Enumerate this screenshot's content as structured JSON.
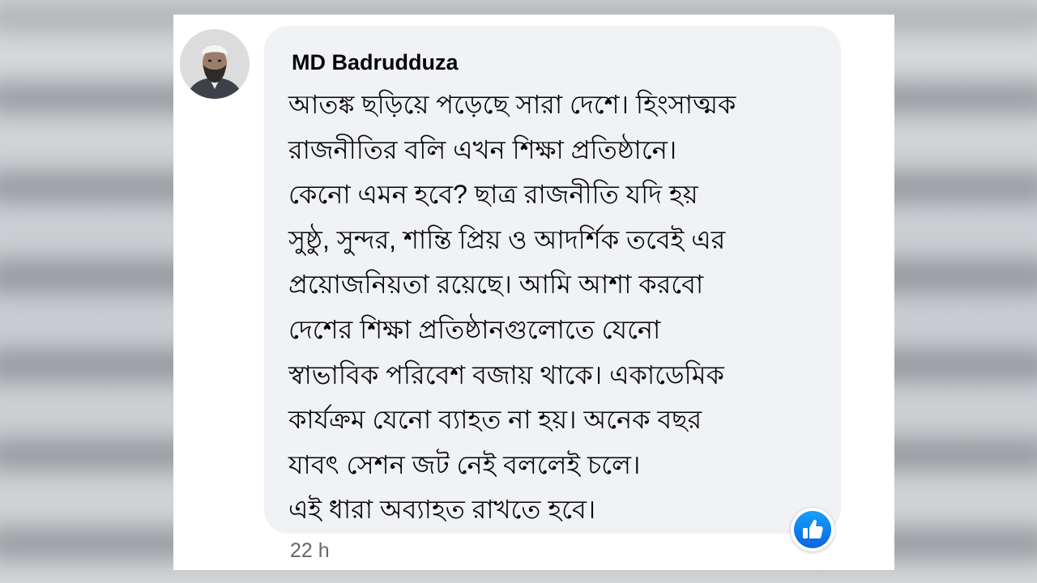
{
  "comment": {
    "author": "MD Badrudduza",
    "lines": [
      "আতঙ্ক ছড়িয়ে পড়েছে সারা দেশে। হিংসাত্মক",
      "রাজনীতির বলি এখন শিক্ষা প্রতিষ্ঠানে।",
      "কেনো এমন হবে? ছাত্র রাজনীতি যদি হয়",
      "সুষ্ঠু, সুন্দর, শান্তি প্রিয় ও আদর্শিক তবেই এর",
      "প্রয়োজনিয়তা রয়েছে। আমি আশা করবো",
      "দেশের শিক্ষা প্রতিষ্ঠানগুলোতে যেনো",
      "স্বাভাবিক পরিবেশ বজায় থাকে। একাডেমিক",
      "কার্যক্রম যেনো ব্যাহত না হয়। অনেক বছর",
      "যাবৎ সেশন জট নেই বললেই চলে।",
      "এই ধারা অব্যাহত রাখতে হবে।"
    ],
    "time": "22 h",
    "reaction_icon": "like-icon"
  },
  "colors": {
    "bubble": "#f0f2f5",
    "like_blue": "#1877f2",
    "time_gray": "#65676b"
  }
}
